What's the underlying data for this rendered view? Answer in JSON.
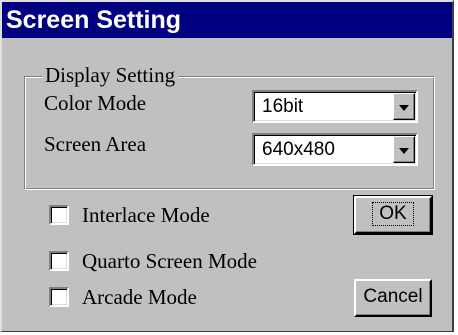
{
  "window": {
    "title": "Screen Setting"
  },
  "display_group": {
    "legend": "Display Setting",
    "color_mode": {
      "label": "Color Mode",
      "selected": "16bit"
    },
    "screen_area": {
      "label": "Screen Area",
      "selected": "640x480"
    }
  },
  "options": [
    {
      "label": "Interlace Mode",
      "checked": false
    },
    {
      "label": "Quarto Screen Mode",
      "checked": false
    },
    {
      "label": "Arcade Mode",
      "checked": false
    }
  ],
  "buttons": {
    "ok_label": "OK",
    "cancel_label": "Cancel"
  },
  "colors": {
    "title_bar": "#000080",
    "face": "#c0c0c0"
  },
  "icons": {
    "dropdown": "chevron-down-icon"
  }
}
